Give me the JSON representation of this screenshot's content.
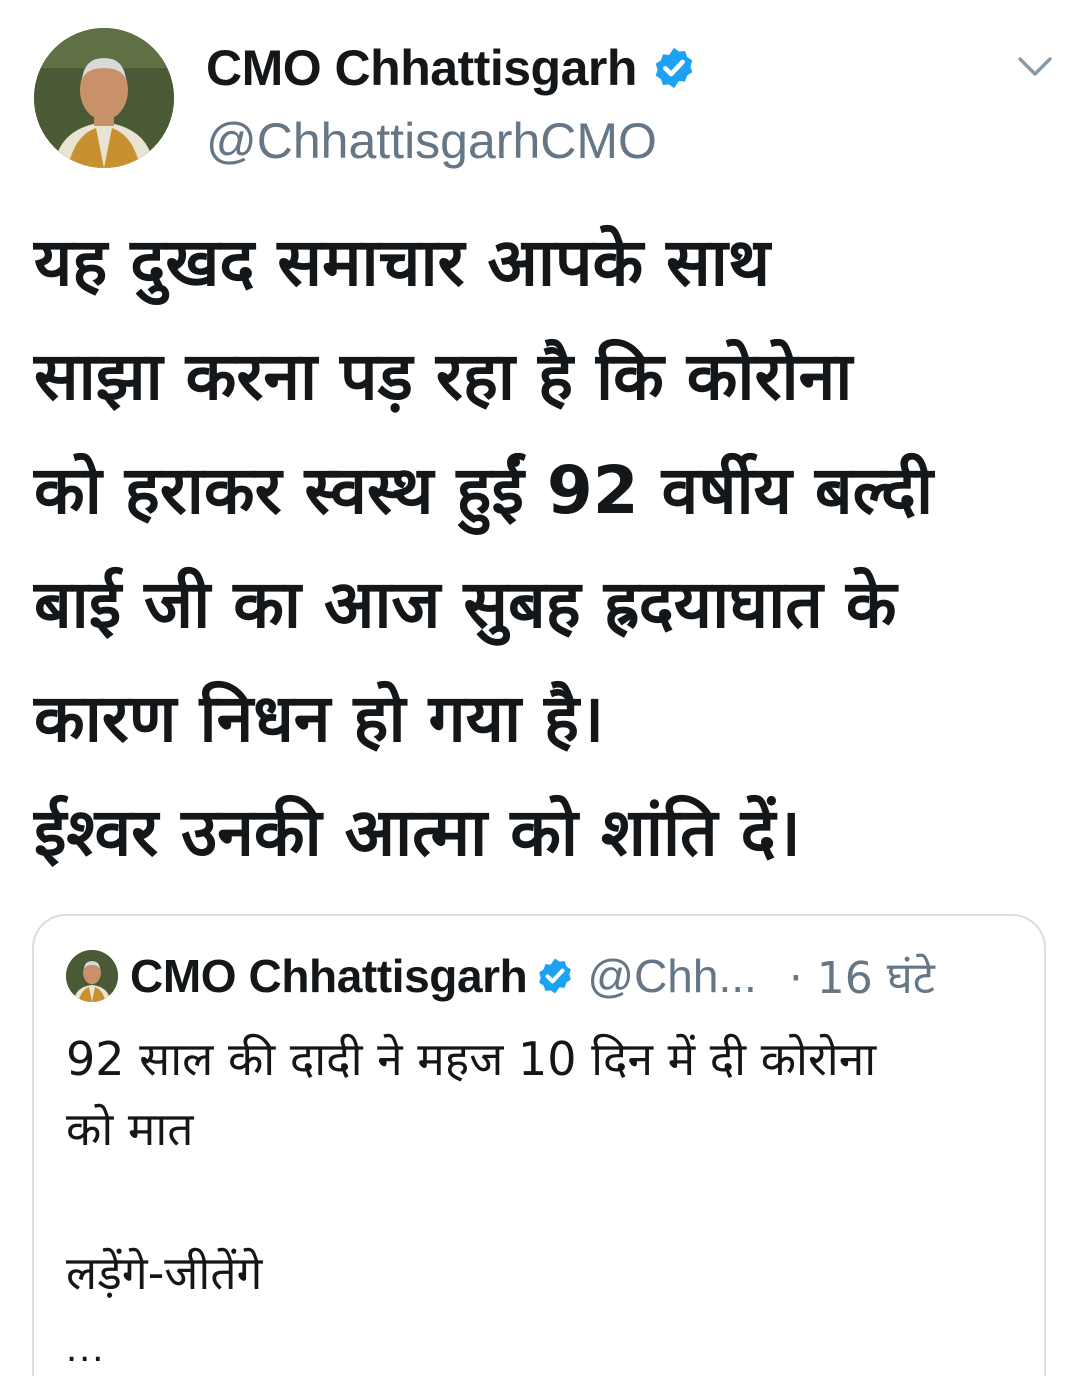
{
  "tweet": {
    "author": {
      "display_name": "CMO Chhattisgarh",
      "handle": "@ChhattisgarhCMO",
      "verified": true
    },
    "text_lines": [
      "यह दुखद समाचार आपके साथ",
      "साझा करना पड़ रहा है कि कोरोना",
      "को हराकर स्वस्थ हुईं 92 वर्षीय बल्दी",
      "बाई जी का आज सुबह ह्रदयाघात के",
      "कारण निधन हो गया है।",
      "ईश्वर उनकी आत्मा को शांति दें।"
    ],
    "menu_icon": "chevron-down-icon"
  },
  "quoted_tweet": {
    "display_name": "CMO Chhattisgarh",
    "handle": "@Chh...",
    "time": "· 16 घंटे",
    "text_lines": [
      "92 साल की दादी ने महज 10 दिन में दी कोरोना",
      "को मात"
    ],
    "hashtag_line": "लड़ेंगे-जीतेंगे",
    "more": "..."
  },
  "colors": {
    "verified_blue": "#1da1f2",
    "secondary_text": "#657786",
    "primary_text": "#14171a",
    "border": "#d6dde3"
  }
}
